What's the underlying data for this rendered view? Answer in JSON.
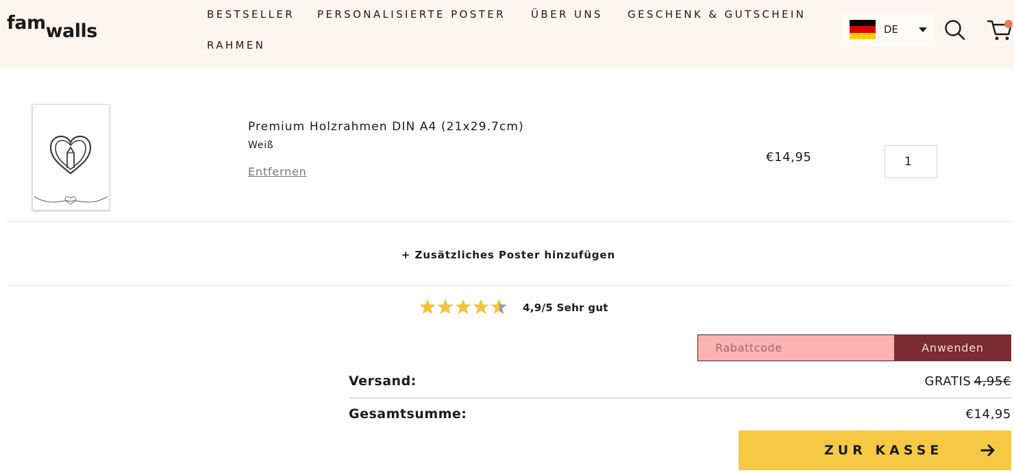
{
  "header": {
    "logo": {
      "part1": "fam",
      "part2": "walls"
    },
    "nav": [
      {
        "label": "BESTSELLER"
      },
      {
        "label": "PERSONALISIERTE POSTER"
      },
      {
        "label": "ÜBER UNS"
      },
      {
        "label": "GESCHENK & GUTSCHEIN"
      },
      {
        "label": "RAHMEN"
      }
    ],
    "language": {
      "code": "DE",
      "flag_colors": [
        "#000000",
        "#dd0000",
        "#ffce00"
      ]
    },
    "icons": {
      "search": "search-icon",
      "cart": "cart-icon",
      "cart_badge_color": "#ea7a63"
    }
  },
  "cart": {
    "items": [
      {
        "title": "Premium Holzrahmen DIN A4 (21x29.7cm)",
        "variant": "Weiß",
        "remove_label": "Entfernen",
        "price": "€14,95",
        "quantity": "1",
        "thumbnail_icon": "heart-pencil-icon"
      }
    ],
    "add_poster_label": "+ Zusätzliches Poster hinzufügen"
  },
  "rating": {
    "value": 4.9,
    "max": 5,
    "text": "4,9/5 Sehr gut",
    "star_color": "#f5c33b"
  },
  "discount": {
    "placeholder": "Rabattcode",
    "apply_label": "Anwenden"
  },
  "summary": {
    "shipping_label": "Versand:",
    "shipping_value": "GRATIS",
    "shipping_old_price": "4,95€",
    "total_label": "Gesamtsumme:",
    "total_value": "€14,95"
  },
  "checkout": {
    "label": "ZUR KASSE",
    "color": "#f6c944"
  }
}
